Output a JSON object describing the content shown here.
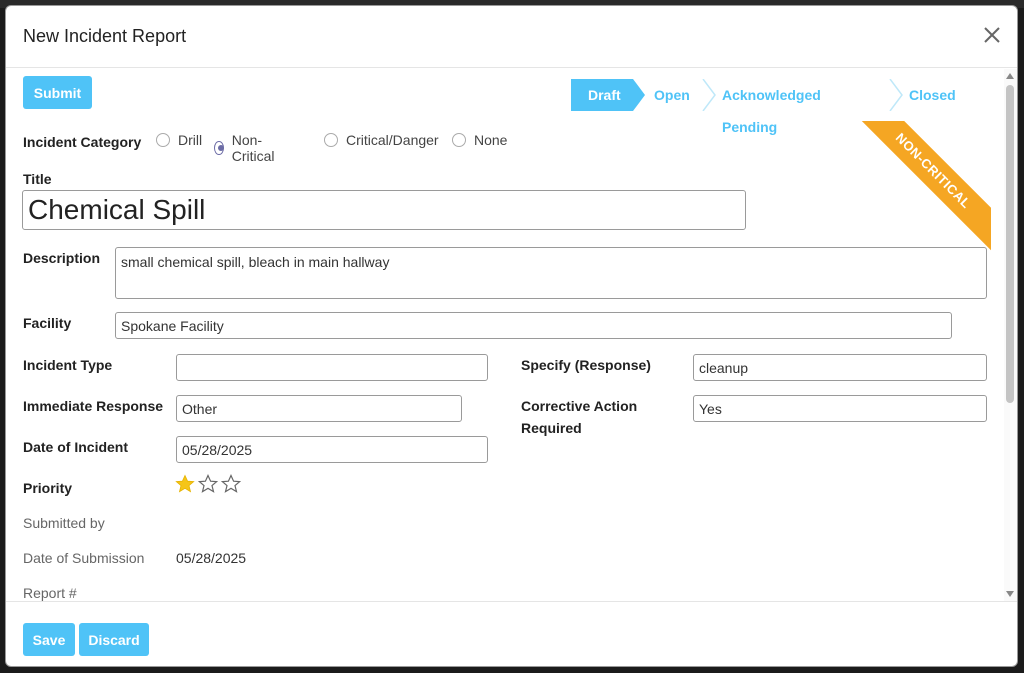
{
  "modal": {
    "title": "New Incident Report"
  },
  "toolbar": {
    "submit_label": "Submit"
  },
  "statusbar": {
    "stages": [
      "Draft",
      "Open",
      "Acknowledged Pending",
      "Closed"
    ],
    "active": "Draft"
  },
  "ribbon": {
    "text": "NON-CRITICAL",
    "color": "#f5a623"
  },
  "category": {
    "label": "Incident Category",
    "options": [
      "Drill",
      "Non-Critical",
      "Critical/Danger",
      "None"
    ],
    "selected": "Non-Critical"
  },
  "title_field": {
    "label": "Title",
    "value": "Chemical Spill"
  },
  "description": {
    "label": "Description",
    "value": "small chemical spill, bleach in main hallway"
  },
  "facility": {
    "label": "Facility",
    "value": "Spokane Facility"
  },
  "incident_type": {
    "label": "Incident Type",
    "value": ""
  },
  "specify_response": {
    "label": "Specify (Response)",
    "value": "cleanup"
  },
  "immediate_response": {
    "label": "Immediate Response",
    "value": "Other"
  },
  "corrective_action": {
    "label_line1": "Corrective Action",
    "label_line2": "Required",
    "value": "Yes"
  },
  "date_of_incident": {
    "label": "Date of Incident",
    "value": "05/28/2025"
  },
  "priority": {
    "label": "Priority",
    "stars_total": 3,
    "stars_filled": 1
  },
  "submitted_by": {
    "label": "Submitted by",
    "value": ""
  },
  "date_of_submission": {
    "label": "Date of Submission",
    "value": "05/28/2025"
  },
  "report_number": {
    "label": "Report #",
    "value": ""
  },
  "footer": {
    "save_label": "Save",
    "discard_label": "Discard"
  },
  "colors": {
    "accent": "#4fc3f7",
    "star": "#f5c518",
    "radio_checked": "#6c6ca6"
  }
}
